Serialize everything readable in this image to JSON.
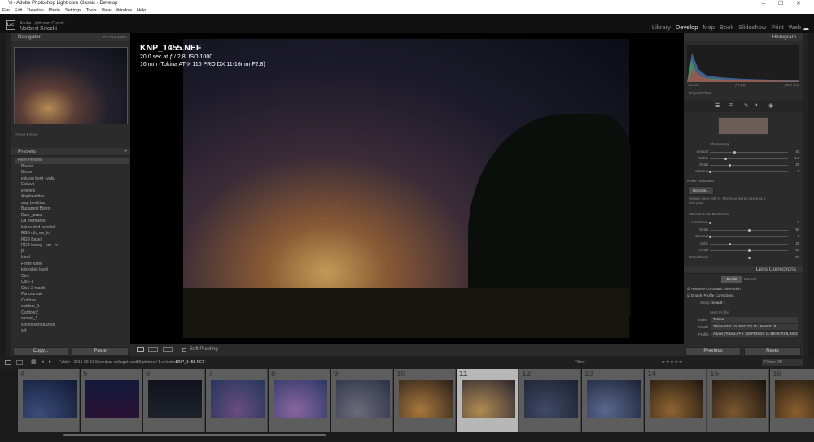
{
  "window": {
    "title": "Yi - Adobe Photoshop Lightroom Classic - Develop"
  },
  "menu": [
    "File",
    "Edit",
    "Develop",
    "Photo",
    "Settings",
    "Tools",
    "View",
    "Window",
    "Help"
  ],
  "identity": {
    "app": "Adobe Lightroom Classic",
    "user": "Norbert Kriczki",
    "logo": "Lrc"
  },
  "modules": [
    "Library",
    "Develop",
    "Map",
    "Book",
    "Slideshow",
    "Print",
    "Web"
  ],
  "active_module": "Develop",
  "navigator": {
    "title": "Navigator",
    "zoom": [
      "FIT",
      "FILL",
      "100%",
      "100%"
    ]
  },
  "presets": {
    "title": "Presets",
    "items": [
      "Filter Presets",
      "Bluesr",
      "Blossr",
      "eskuvo bent - vaku",
      "Eskuvo",
      "ehelfels",
      "Alapbeallitas",
      "alap beallitas",
      "Budapest Bistro",
      "Dark_pizza",
      "Da mertekteki",
      "kekes kisd kerettel",
      "RGB dib_vm_kr",
      "RGB Basel",
      "RGB tuning - vm - k:",
      "P",
      "karel",
      "Fehér karel",
      "kekeskek karel",
      "Clo1",
      "Clo1-1",
      "Clo1-2-masik",
      "Panoramaic",
      "Outdoor",
      "outdoor_1",
      "Outdoor2",
      "sunset_1",
      "szines kontrasztos",
      "szt"
    ]
  },
  "left_buttons": {
    "copy": "Copy...",
    "paste": "Paste"
  },
  "photo": {
    "filename": "KNP_1455.NEF",
    "exposure": "20.0 sec at ƒ / 2,8, ISO 1000",
    "lens": "16 mm (Tokina AT-X 116 PRO DX 11-16mm F2.8)"
  },
  "toolbar": {
    "soft_proofing": "Soft Proofing"
  },
  "right": {
    "histogram": "Histogram",
    "hist_left": "16 mm",
    "hist_mid": "ƒ / 2.8",
    "hist_right": "20.0 sec",
    "original_photo": "Original Photo",
    "sharpening": {
      "title": "Sharpening",
      "rows": [
        {
          "label": "Amount",
          "value": "40",
          "level": 0.31
        },
        {
          "label": "Radius",
          "value": "1.0",
          "level": 0.2
        },
        {
          "label": "Detail",
          "value": "25",
          "level": 0.25
        },
        {
          "label": "Masking",
          "value": "0",
          "level": 0.0
        }
      ]
    },
    "noise": {
      "title": "Noise Reduction",
      "denoise": "Denoise...",
      "note": "Reduce noise with AI. The result will be saved as a new DNG.",
      "manual": "Manual Noise Reduction",
      "rows": [
        {
          "label": "Luminance",
          "value": "0",
          "level": 0.0
        },
        {
          "label": "Detail",
          "value": "50",
          "level": 0.5
        },
        {
          "label": "Contrast",
          "value": "0",
          "level": 0.0
        },
        {
          "label": "Color",
          "value": "25",
          "level": 0.25
        },
        {
          "label": "Detail",
          "value": "50",
          "level": 0.5
        },
        {
          "label": "Smoothness",
          "value": "50",
          "level": 0.5
        }
      ]
    },
    "lens": {
      "title": "Lens Corrections",
      "tabs": [
        "Profile",
        "Manual"
      ],
      "remove_ca": "Remove Chromatic Aberration",
      "enable_profile": "Enable Profile Corrections",
      "setup_label": "Setup",
      "setup": "Default",
      "lens_profile": "Lens Profile",
      "make_label": "Make",
      "make": "Tokina",
      "model_label": "Model",
      "model": "Tokina AT-X 116 PRO DX 11-16mm F2.8",
      "profile_label": "Profile",
      "profile": "Adobe (Tokina AT-X 116 PRO DX 11-16mm F2.8, NIKON)"
    },
    "previous": "Previous",
    "reset": "Reset"
  },
  "filmstrip": {
    "info": "Folder : 2016-09-11 Szendvar csillagok alatt",
    "count": "39 photos / 1 selected /",
    "selected": "KNP_1455.NEF",
    "filter": "Filter :",
    "filters_off": "Filters Off",
    "cells": [
      "4",
      "5",
      "6",
      "7",
      "8",
      "9",
      "10",
      "11",
      "12",
      "13",
      "14",
      "15",
      "16"
    ],
    "selected_index": 7
  }
}
